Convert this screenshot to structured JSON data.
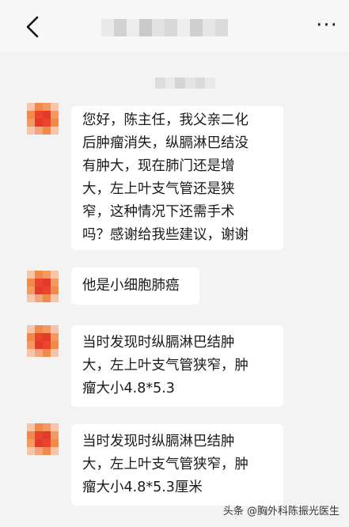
{
  "header": {
    "back_icon": "chevron-left-icon",
    "more_label": "···"
  },
  "messages": [
    {
      "text": "您好，陈主任，我父亲二化\n后肿瘤消失，纵膈淋巴结没\n有肿大，现在肺门还是增\n大，左上叶支气管还是狭\n窄，这种情况下还需手术\n吗？感谢给我些建议，谢谢"
    },
    {
      "text": "他是小细胞肺癌"
    },
    {
      "text": "当时发现时纵膈淋巴结肿\n大，左上叶支气管狭窄，肿\n瘤大小4.8*5.3"
    },
    {
      "text": "当时发现时纵膈淋巴结肿\n大，左上叶支气管狭窄，肿\n瘤大小4.8*5.3厘米"
    }
  ],
  "watermark": "头条 @胸外科陈振光医生",
  "colors": {
    "background": "#f3f3f3",
    "bubble": "#ffffff",
    "avatar_red": "#e8452c",
    "avatar_orange": "#f08a4b",
    "avatar_peach": "#f6c4a8"
  }
}
